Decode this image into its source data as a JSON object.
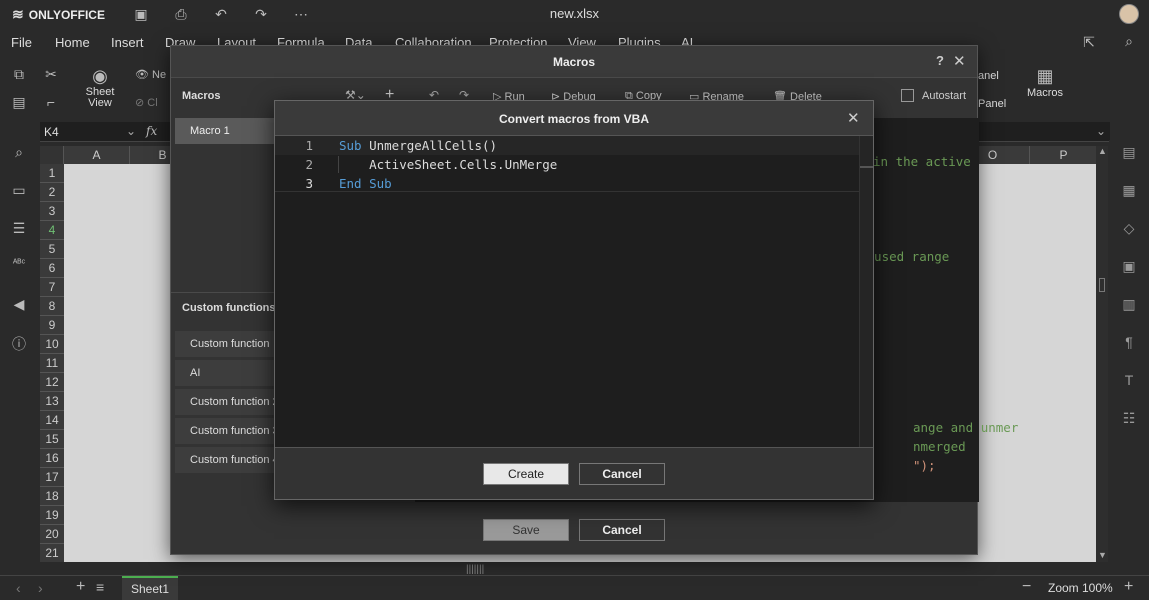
{
  "app": {
    "brand": "ONLYOFFICE",
    "doc_title": "new.xlsx"
  },
  "menu": [
    "File",
    "Home",
    "Insert",
    "Draw",
    "Layout",
    "Formula",
    "Data",
    "Collaboration",
    "Protection",
    "View",
    "Plugins",
    "AI"
  ],
  "toolbar": {
    "sheet_view": "Sheet View",
    "macros": "Macros",
    "panel1": "anel",
    "panel2": "Panel",
    "new_label": "Ne",
    "cl_label": "Cl"
  },
  "formula_bar": {
    "cell_ref": "K4",
    "fx": "fx"
  },
  "sheet": {
    "columns": [
      "A",
      "B",
      "O",
      "P"
    ],
    "rows": [
      "1",
      "2",
      "3",
      "4",
      "5",
      "6",
      "7",
      "8",
      "9",
      "10",
      "11",
      "12",
      "13",
      "14",
      "15",
      "16",
      "17",
      "18",
      "19",
      "20",
      "21"
    ]
  },
  "status": {
    "sheet_tab": "Sheet1",
    "zoom": "Zoom 100%"
  },
  "macros_dialog": {
    "title": "Macros",
    "help": "?",
    "macros_label": "Macros",
    "macro_items": [
      "Macro 1"
    ],
    "custom_functions_label": "Custom functions",
    "custom_functions": [
      "Custom function",
      "AI",
      "Custom function 2",
      "Custom function 3",
      "Custom function 4"
    ],
    "toolbar": {
      "run": "Run",
      "debug": "Debug",
      "copy": "Copy",
      "rename": "Rename",
      "delete": "Delete",
      "autostart": "Autostart"
    },
    "code_fragments": {
      "l1": "in the active",
      "l2": "e used range",
      "l3": "ange and unmer",
      "l4": "nmerged",
      "l5": "\");"
    },
    "save": "Save",
    "cancel": "Cancel"
  },
  "convert_dialog": {
    "title": "Convert macros from VBA",
    "lines": [
      {
        "num": "1",
        "kw1": "Sub",
        "text": " UnmergeAllCells()",
        "kw2": ""
      },
      {
        "num": "2",
        "kw1": "",
        "text": "    ActiveSheet.Cells.UnMerge",
        "kw2": ""
      },
      {
        "num": "3",
        "kw1": "End",
        "text": " ",
        "kw2": "Sub"
      }
    ],
    "create": "Create",
    "cancel": "Cancel"
  },
  "colors": {
    "keyword": "#569cd6",
    "accent": "#4caf50"
  }
}
